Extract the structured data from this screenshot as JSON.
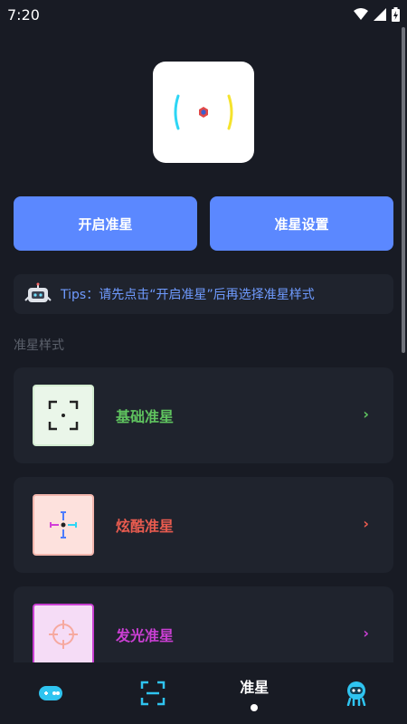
{
  "status_bar": {
    "time": "7:20"
  },
  "actions": {
    "open_label": "开启准星",
    "settings_label": "准星设置"
  },
  "tips": {
    "text": "Tips：请先点击“开启准星”后再选择准星样式"
  },
  "section": {
    "title": "准星样式"
  },
  "styles": [
    {
      "label": "基础准星",
      "color": "#5fc35f",
      "thumb_bg": "#eaf6e9"
    },
    {
      "label": "炫酷准星",
      "color": "#e85b4f",
      "thumb_bg": "#fde1dd"
    },
    {
      "label": "发光准星",
      "color": "#c93fd2",
      "thumb_bg": "#f5dcf6"
    }
  ],
  "nav": {
    "active_label": "准星"
  },
  "colors": {
    "accent": "#5b88ff",
    "tips_text": "#6f9bff",
    "background": "#181b24",
    "card": "#1f232d"
  }
}
